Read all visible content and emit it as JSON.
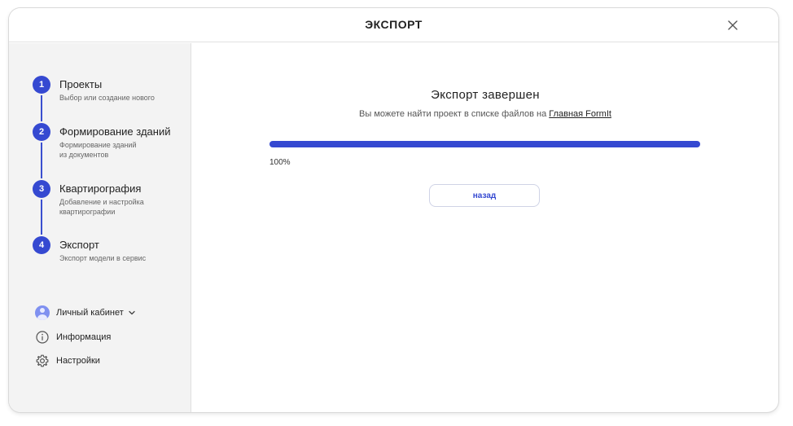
{
  "header": {
    "title": "ЭКСПОРТ"
  },
  "steps": [
    {
      "num": "1",
      "title": "Проекты",
      "subtitle": "Выбор или создание нового"
    },
    {
      "num": "2",
      "title": "Формирование зданий",
      "subtitle": "Формирование зданий из документов"
    },
    {
      "num": "3",
      "title": "Квартирография",
      "subtitle": "Добавление и настройка квартирографии"
    },
    {
      "num": "4",
      "title": "Экспорт",
      "subtitle": "Экспорт модели в сервис"
    }
  ],
  "sidebar_links": {
    "account": "Личный кабинет",
    "info": "Информация",
    "settings": "Настройки"
  },
  "main": {
    "title": "Экспорт завершен",
    "subtitle_prefix": "Вы можете найти проект в списке файлов на ",
    "subtitle_link": "Главная FormIt",
    "progress_percent": 100,
    "progress_label": "100%",
    "back_button": "назад"
  },
  "colors": {
    "accent": "#3549d1",
    "sidebar_bg": "#f3f3f3",
    "avatar": "#7f90f0"
  }
}
